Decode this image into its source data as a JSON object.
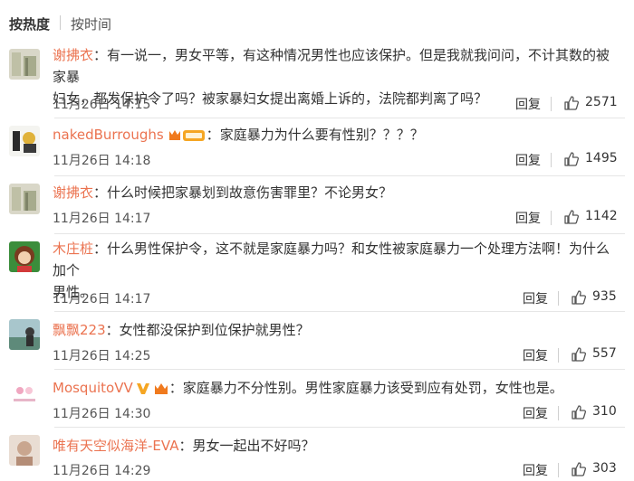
{
  "sort": {
    "hot": "按热度",
    "time": "按时间"
  },
  "comments": [
    {
      "user": "谢拂衣",
      "text": "有一说一，男女平等，有这种情况男性也应该保护。但是我就我问问，不计其数的被家暴妇女，都发保护令了吗？被家暴妇女提出离婚上诉的，法院都判离了吗？",
      "line1": "有一说一，男女平等，有这种情况男性也应该保护。但是我就我问问，不计其数的被家暴",
      "line2": "妇女，都发保护令了吗？被家暴妇女提出离婚上诉的，法院都判离了吗？",
      "time": "11月26日 14:15",
      "reply": "回复",
      "likes": "2571"
    },
    {
      "user": "nakedBurroughs",
      "text": "家庭暴力为什么要有性别？？？？",
      "time": "11月26日 14:18",
      "reply": "回复",
      "likes": "1495"
    },
    {
      "user": "谢拂衣",
      "text": "什么时候把家暴划到故意伤害罪里？不论男女？",
      "time": "11月26日 14:17",
      "reply": "回复",
      "likes": "1142"
    },
    {
      "user": "木庄桩",
      "text": "什么男性保护令，这不就是家庭暴力吗？和女性被家庭暴力一个处理方法啊！为什么加个男性。",
      "line1": "什么男性保护令，这不就是家庭暴力吗？和女性被家庭暴力一个处理方法啊！为什么加个",
      "line2": "男性。",
      "time": "11月26日 14:17",
      "reply": "回复",
      "likes": "935"
    },
    {
      "user": "飘飘223",
      "text": "女性都没保护到位保护就男性？",
      "time": "11月26日 14:25",
      "reply": "回复",
      "likes": "557"
    },
    {
      "user": "MosquitoVV",
      "text": "家庭暴力不分性别。男性家庭暴力该受到应有处罚，女性也是。",
      "time": "11月26日 14:30",
      "reply": "回复",
      "likes": "310"
    },
    {
      "user": "唯有天空似海洋-EVA",
      "text": "男女一起出不好吗？",
      "time": "11月26日 14:29",
      "reply": "回复",
      "likes": "303"
    }
  ],
  "colors": {
    "username": "#eb7350",
    "text": "#333333",
    "divider": "#e6e6e6"
  },
  "icons": {
    "like": "thumbs-up-icon",
    "vip": "vip-badge-icon",
    "verified": "v-verified-icon"
  }
}
